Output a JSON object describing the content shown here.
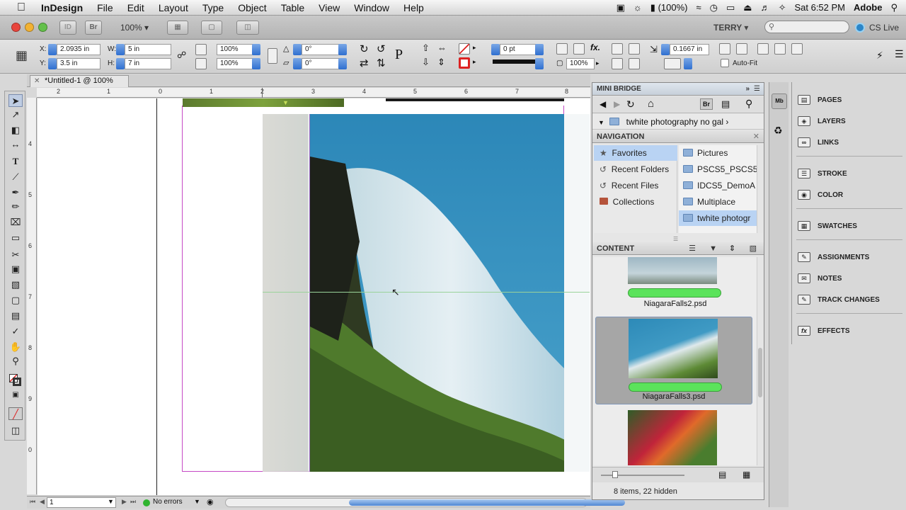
{
  "menubar": {
    "app_name": "InDesign",
    "menus": [
      "File",
      "Edit",
      "Layout",
      "Type",
      "Object",
      "Table",
      "View",
      "Window",
      "Help"
    ],
    "battery": "(100%)",
    "clock": "Sat 6:52 PM",
    "user": "Adobe"
  },
  "appbar": {
    "zoom": "100%",
    "workspace": "TERRY",
    "cs_live": "CS Live",
    "br_label": "Br"
  },
  "control": {
    "x_label": "X:",
    "x_value": "2.0935 in",
    "y_label": "Y:",
    "y_value": "3.5 in",
    "w_label": "W:",
    "w_value": "5 in",
    "h_label": "H:",
    "h_value": "7 in",
    "scale_x": "100%",
    "scale_y": "100%",
    "rotate": "0°",
    "shear": "0°",
    "stroke_weight": "0 pt",
    "opacity": "100%",
    "offset": "0.1667 in",
    "auto_fit": "Auto-Fit"
  },
  "document": {
    "tab_title": "*Untitled-1 @ 100%",
    "ruler_h": [
      "2",
      "1",
      "0",
      "1",
      "2",
      "3",
      "4",
      "5",
      "6",
      "7",
      "8"
    ],
    "ruler_v": [
      "4",
      "5",
      "6",
      "7",
      "8",
      "9",
      "0"
    ],
    "page_number": "1",
    "preflight": "No errors"
  },
  "minibridge": {
    "title": "MINI BRIDGE",
    "path": "twhite photography no gal",
    "navigation_title": "NAVIGATION",
    "nav_left": [
      "Favorites",
      "Recent Folders",
      "Recent Files",
      "Collections"
    ],
    "nav_right": [
      "Pictures",
      "PSCS5_PSCS5e",
      "IDCS5_DemoA",
      "Multiplace",
      "twhite photogr"
    ],
    "content_title": "CONTENT",
    "files": [
      "NiagaraFalls2.psd",
      "NiagaraFalls3.psd"
    ],
    "footer": "8 items, 22 hidden"
  },
  "panels": {
    "items": [
      "PAGES",
      "LAYERS",
      "LINKS",
      "STROKE",
      "COLOR",
      "SWATCHES",
      "ASSIGNMENTS",
      "NOTES",
      "TRACK CHANGES",
      "EFFECTS"
    ],
    "icons": [
      "pages-icon",
      "layers-icon",
      "links-icon",
      "stroke-icon",
      "color-icon",
      "swatches-icon",
      "assignments-icon",
      "notes-icon",
      "track-changes-icon",
      "effects-icon"
    ]
  },
  "colors": {
    "accent": "#3d7fd6",
    "selection": "#b9d3f3",
    "frame": "#a23ad6",
    "rating": "#5be35b"
  }
}
